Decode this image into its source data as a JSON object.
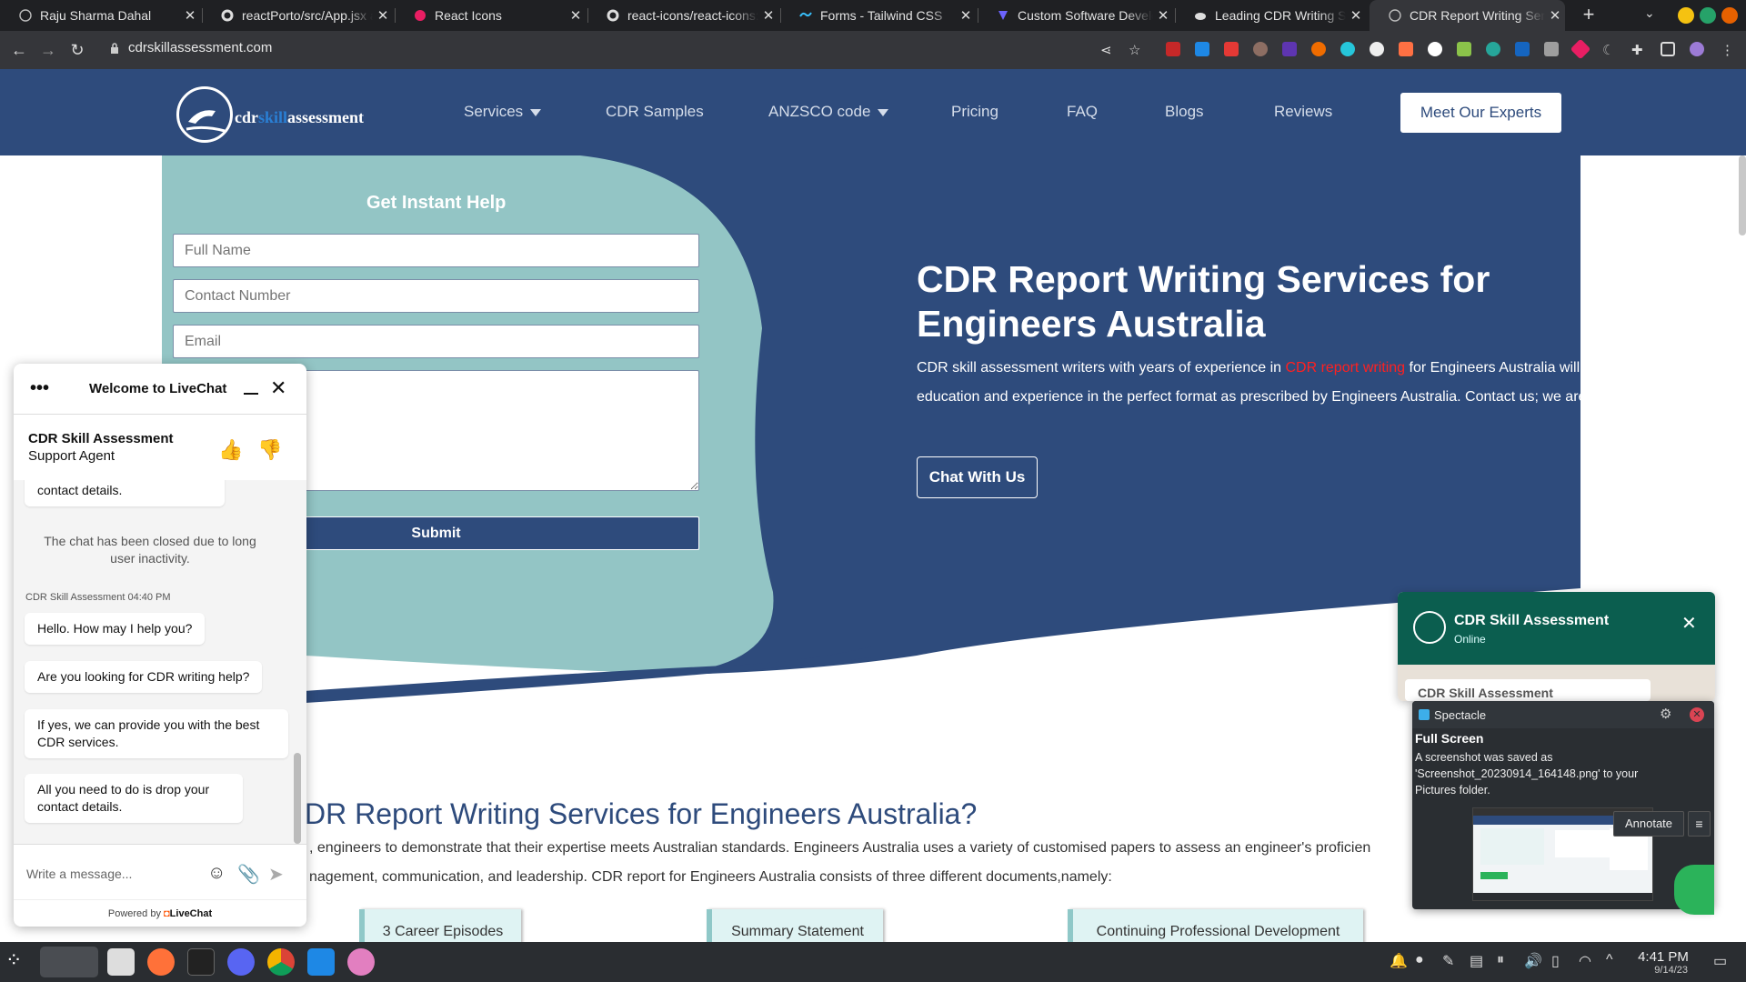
{
  "browser": {
    "tabs": [
      {
        "title": "Raju Sharma Dahal",
        "icon": "globe-icon"
      },
      {
        "title": "reactPorto/src/App.jsx at",
        "icon": "github-icon"
      },
      {
        "title": "React Icons",
        "icon": "react-icons-icon"
      },
      {
        "title": "react-icons/react-icons: s",
        "icon": "github-icon"
      },
      {
        "title": "Forms - Tailwind CSS",
        "icon": "tailwind-icon"
      },
      {
        "title": "Custom Software Develo",
        "icon": "company-icon"
      },
      {
        "title": "Leading CDR Writing Ser",
        "icon": "cloud-icon"
      },
      {
        "title": "CDR Report Writing Serv",
        "icon": "globe-icon",
        "active": true
      }
    ],
    "url": "cdrskillassessment.com"
  },
  "header": {
    "logo_left": "cdr",
    "logo_mid": "skill",
    "logo_right": "assessment",
    "nav": [
      "Services",
      "CDR Samples",
      "ANZSCO code",
      "Pricing",
      "FAQ",
      "Blogs",
      "Reviews"
    ],
    "cta": "Meet Our Experts"
  },
  "form": {
    "title": "Get Instant Help",
    "full_name_placeholder": "Full Name",
    "contact_placeholder": "Contact Number",
    "email_placeholder": "Email",
    "submit": "Submit"
  },
  "hero": {
    "title": "CDR Report Writing Services for Engineers Australia",
    "desc_before": "CDR skill assessment writers with years of experience in ",
    "desc_link": "CDR report writing",
    "desc_after": " for Engineers Australia will present your skills, education and experience in the perfect format as prescribed by Engineers Australia. Contact us; we are eager to help you.",
    "button": "Chat With Us"
  },
  "section2": {
    "title": "DR Report Writing Services for Engineers Australia?",
    "line1": ", engineers to demonstrate that their expertise meets Australian standards. Engineers Australia uses a variety of customised papers to assess an engineer's proficien",
    "line2": "nagement, communication, and leadership. CDR report for Engineers Australia consists of three different documents,namely:",
    "documents": [
      "3 Career Episodes",
      "Summary Statement",
      "Continuing Professional Development"
    ]
  },
  "livechat": {
    "title": "Welcome to LiveChat",
    "agent": "CDR Skill Assessment",
    "role": "Support Agent",
    "partial_message": "contact details.",
    "system_message": "The chat has been closed due to long user inactivity.",
    "meta": "CDR Skill Assessment 04:40 PM",
    "messages": [
      "Hello. How may I help you?",
      "Are you looking for CDR writing help?",
      "If yes, we can provide you with the best CDR services.",
      "All you need to do is drop your contact details."
    ],
    "input_placeholder": "Write a message...",
    "powered_by": "Powered by",
    "brand": "LiveChat"
  },
  "whatsapp": {
    "name": "CDR Skill Assessment",
    "status": "Online",
    "preview": "CDR Skill Assessment"
  },
  "spectacle": {
    "app": "Spectacle",
    "title": "Full Screen",
    "message": "A screenshot was saved as 'Screenshot_20230914_164148.png' to your Pictures folder.",
    "annotate": "Annotate"
  },
  "taskbar": {
    "time": "4:41 PM",
    "date": "9/14/23"
  },
  "colors": {
    "brand_blue": "#2e4b7c",
    "teal": "#93c5c5",
    "highlight_red": "#ff2020",
    "whatsapp_green": "#0b5e4f"
  }
}
